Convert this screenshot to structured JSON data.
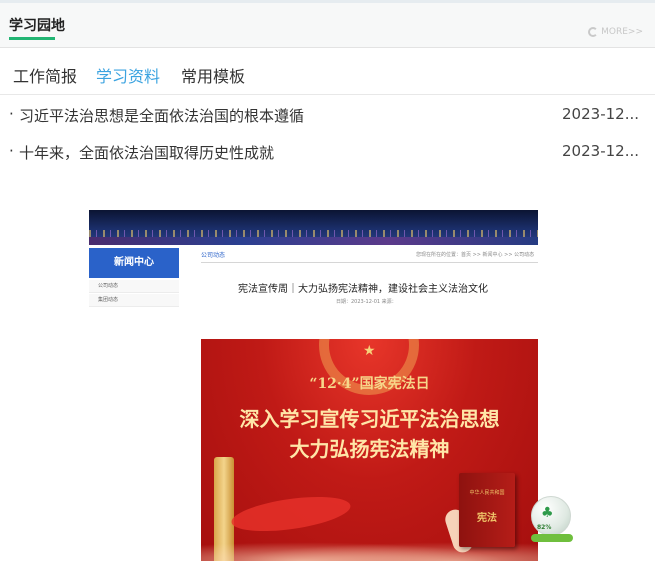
{
  "panel": {
    "title": "学习园地",
    "more_label": "MORE>>",
    "accent_color": "#22b573"
  },
  "tabs": [
    {
      "label": "工作简报",
      "active": false
    },
    {
      "label": "学习资料",
      "active": true
    },
    {
      "label": "常用模板",
      "active": false
    }
  ],
  "news": [
    {
      "bullet": "·",
      "title": "习近平法治思想是全面依法治国的根本遵循",
      "date": "2023-12..."
    },
    {
      "bullet": "·",
      "title": "十年来，全面依法治国取得历史性成就",
      "date": "2023-12..."
    }
  ],
  "embedded_page": {
    "side_heading": "新闻中心",
    "side_items": [
      "公司动态",
      "集团动态"
    ],
    "crumb_left": "公司动态",
    "crumb_right": "您现在所在的位置：首页 >> 新闻中心 >> 公司动态",
    "article_title": "宪法宣传周｜大力弘扬宪法精神，建设社会主义法治文化",
    "article_meta": "日期：2023-12-01 来源："
  },
  "poster": {
    "sub_heading": "“12·4”国家宪法日",
    "heading_line1": "深入学习宣传习近平法治思想",
    "heading_line2": "大力弘扬宪法精神",
    "book_top": "中华人民共和国",
    "book_title": "宪法"
  },
  "widget": {
    "percent": "82%",
    "icon": "tree-icon"
  }
}
